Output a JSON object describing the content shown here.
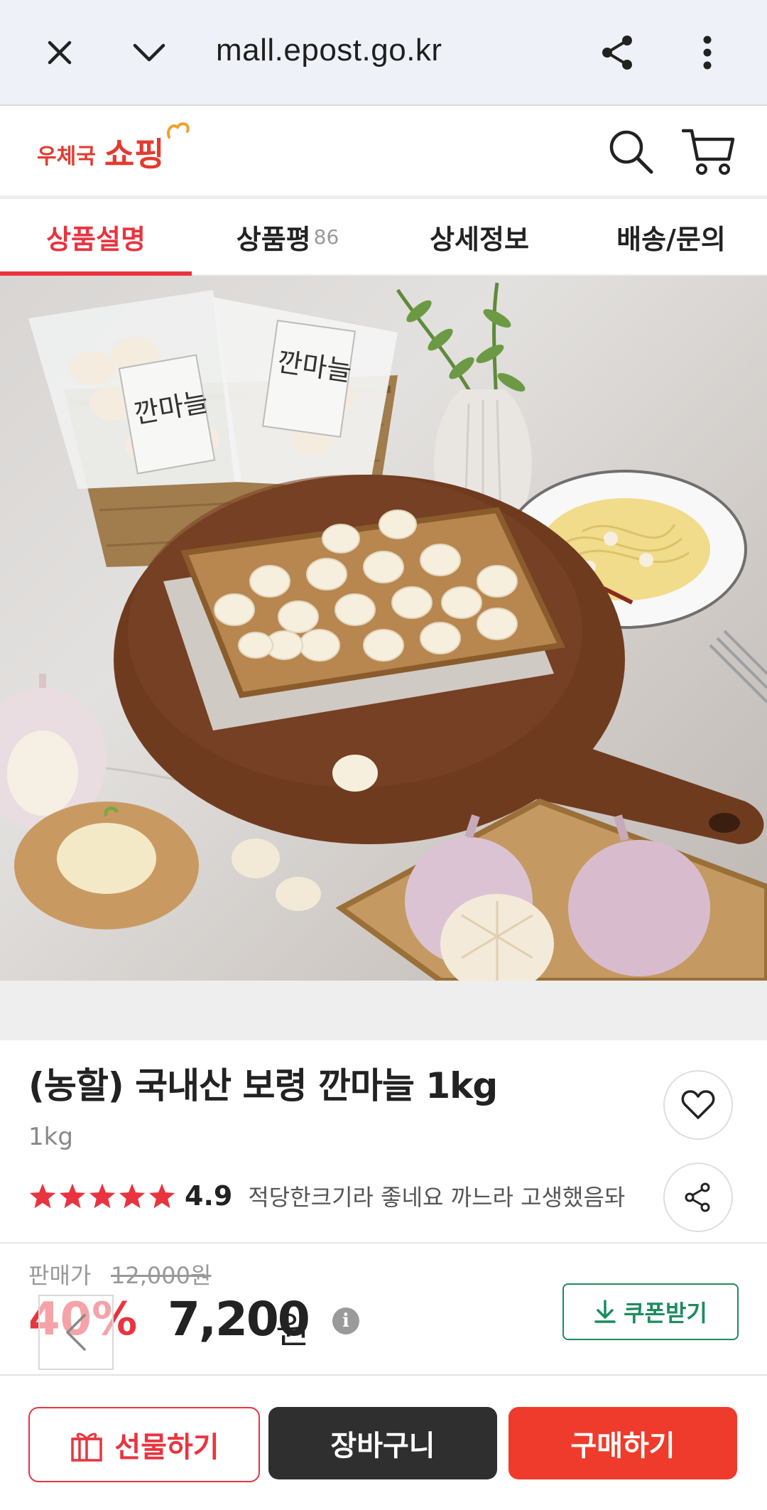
{
  "browser": {
    "url": "mall.epost.go.kr",
    "icons": [
      "close-icon",
      "chevron-down-icon",
      "share-icon",
      "more-vertical-icon"
    ]
  },
  "header": {
    "logo_small": "우체국",
    "logo_big": "쇼핑",
    "icons": [
      "search-icon",
      "cart-icon"
    ]
  },
  "tabs": [
    {
      "label": "상품설명",
      "active": true
    },
    {
      "label": "상품평",
      "count": "86"
    },
    {
      "label": "상세정보"
    },
    {
      "label": "배송/문의"
    }
  ],
  "product": {
    "title": "(농할) 국내산 보령 깐마늘 1kg",
    "option": "1kg",
    "rating": "4.9",
    "stars": 5,
    "review_snippet": "적당한크기라 좋네요 까느라 고생했음돠",
    "package_label": "깐마늘"
  },
  "price": {
    "label": "판매가",
    "original": "12,000원",
    "discount": "40%",
    "sale": "7,200",
    "currency": "원",
    "info_icon": "i",
    "coupon_label": "쿠폰받기"
  },
  "actions": {
    "gift": "선물하기",
    "cart": "장바구니",
    "buy": "구매하기"
  },
  "colors": {
    "accent_red": "#e9343f",
    "buy_red": "#ee3b2b",
    "coupon_green": "#1e8b5e",
    "dark_button": "#2f2f2f"
  }
}
